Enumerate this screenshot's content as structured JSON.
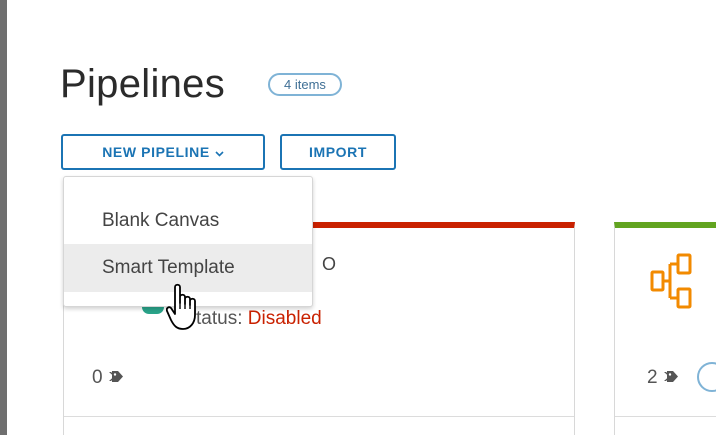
{
  "header": {
    "title": "Pipelines",
    "count_badge": "4 items"
  },
  "toolbar": {
    "new_pipeline_label": "NEW PIPELINE",
    "import_label": "IMPORT"
  },
  "dropdown": {
    "items": [
      {
        "label": "Blank Canvas"
      },
      {
        "label": "Smart Template"
      }
    ]
  },
  "cards": [
    {
      "name_fragment": "O",
      "status_label": "tatus:",
      "status_value": "Disabled",
      "tag_count": "0",
      "accent_color": "#c92100"
    },
    {
      "tag_count": "2",
      "accent_color": "#62a420",
      "icon": "pipeline-icon"
    }
  ],
  "colors": {
    "primary": "#1b74b4",
    "danger": "#c92100",
    "success": "#62a420",
    "pipeline_icon": "#f28a00"
  }
}
